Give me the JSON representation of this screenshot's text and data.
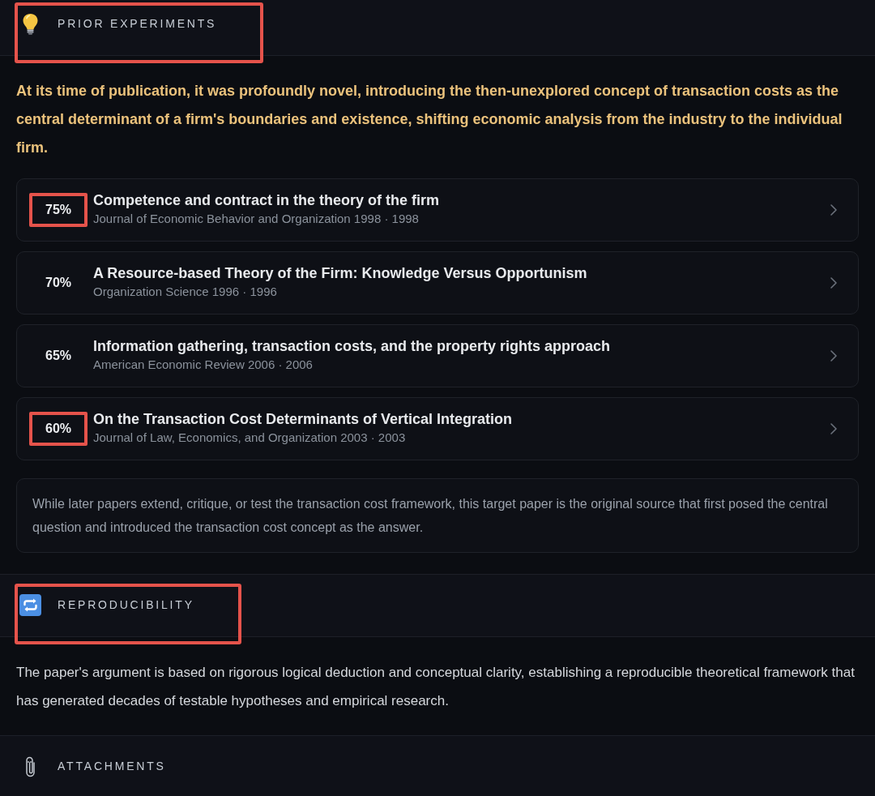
{
  "sections": [
    {
      "kind": "papers",
      "title": "PRIOR EXPERIMENTS",
      "highlighted": true,
      "summary": "At its time of publication, it was profoundly novel, introducing the then-unexplored concept of transaction costs as the central determinant of a firm's boundaries and existence, shifting economic analysis from the industry to the individual firm.",
      "papers": [
        {
          "score": "75%",
          "title": "Competence and contract in the theory of the firm",
          "meta": "Journal of Economic Behavior and Organization 1998 · 1998",
          "highlighted": true
        },
        {
          "score": "70%",
          "title": "A Resource-based Theory of the Firm: Knowledge Versus Opportunism",
          "meta": "Organization Science 1996 · 1996",
          "highlighted": false
        },
        {
          "score": "65%",
          "title": "Information gathering, transaction costs, and the property rights approach",
          "meta": "American Economic Review 2006 · 2006",
          "highlighted": false
        },
        {
          "score": "60%",
          "title": "On the Transaction Cost Determinants of Vertical Integration",
          "meta": "Journal of Law, Economics, and Organization 2003 · 2003",
          "highlighted": true
        }
      ],
      "note": "While later papers extend, critique, or test the transaction cost framework, this target paper is the original source that first posed the central question and introduced the transaction cost concept as the answer."
    },
    {
      "kind": "text",
      "title": "REPRODUCIBILITY",
      "highlighted": true,
      "body": "The paper's argument is based on rigorous logical deduction and conceptual clarity, establishing a reproducible theoretical framework that has generated decades of testable hypotheses and empirical research."
    },
    {
      "kind": "header",
      "title": "ATTACHMENTS",
      "highlighted": false
    }
  ]
}
